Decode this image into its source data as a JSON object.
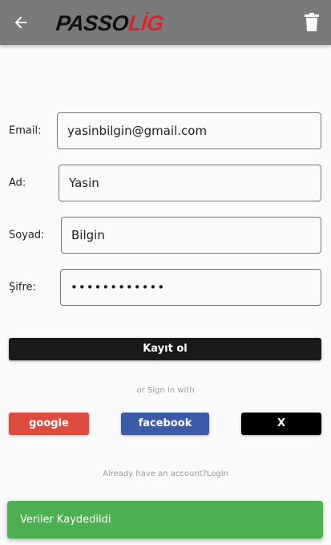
{
  "colors": {
    "appbar": "#7a7a7a",
    "primary_button": "#1a1a1a",
    "google": "#de4b3f",
    "facebook": "#3b5aa8",
    "x": "#000000",
    "snackbar": "#4caf50",
    "logo_red": "#d6262f"
  },
  "appbar": {
    "back_icon": "arrow-left-icon",
    "logo_part1": "PASSO",
    "logo_part2": "LİG",
    "delete_icon": "trash-icon"
  },
  "form": {
    "email": {
      "label": "Email:",
      "value": "yasinbilgin@gmail.com"
    },
    "first_name": {
      "label": "Ad:",
      "value": "Yasin"
    },
    "last_name": {
      "label": "Soyad:",
      "value": "Bilgin"
    },
    "password": {
      "label": "Şifre:",
      "value": "••••••••••••"
    }
  },
  "register_button": "Kayıt ol",
  "or_sign_in_with": "or Sign In with",
  "social": {
    "google": "google",
    "facebook": "facebook",
    "x": "X"
  },
  "already_have_account": "Already have an account?Login",
  "snackbar_message": "Veriler Kaydedildi"
}
